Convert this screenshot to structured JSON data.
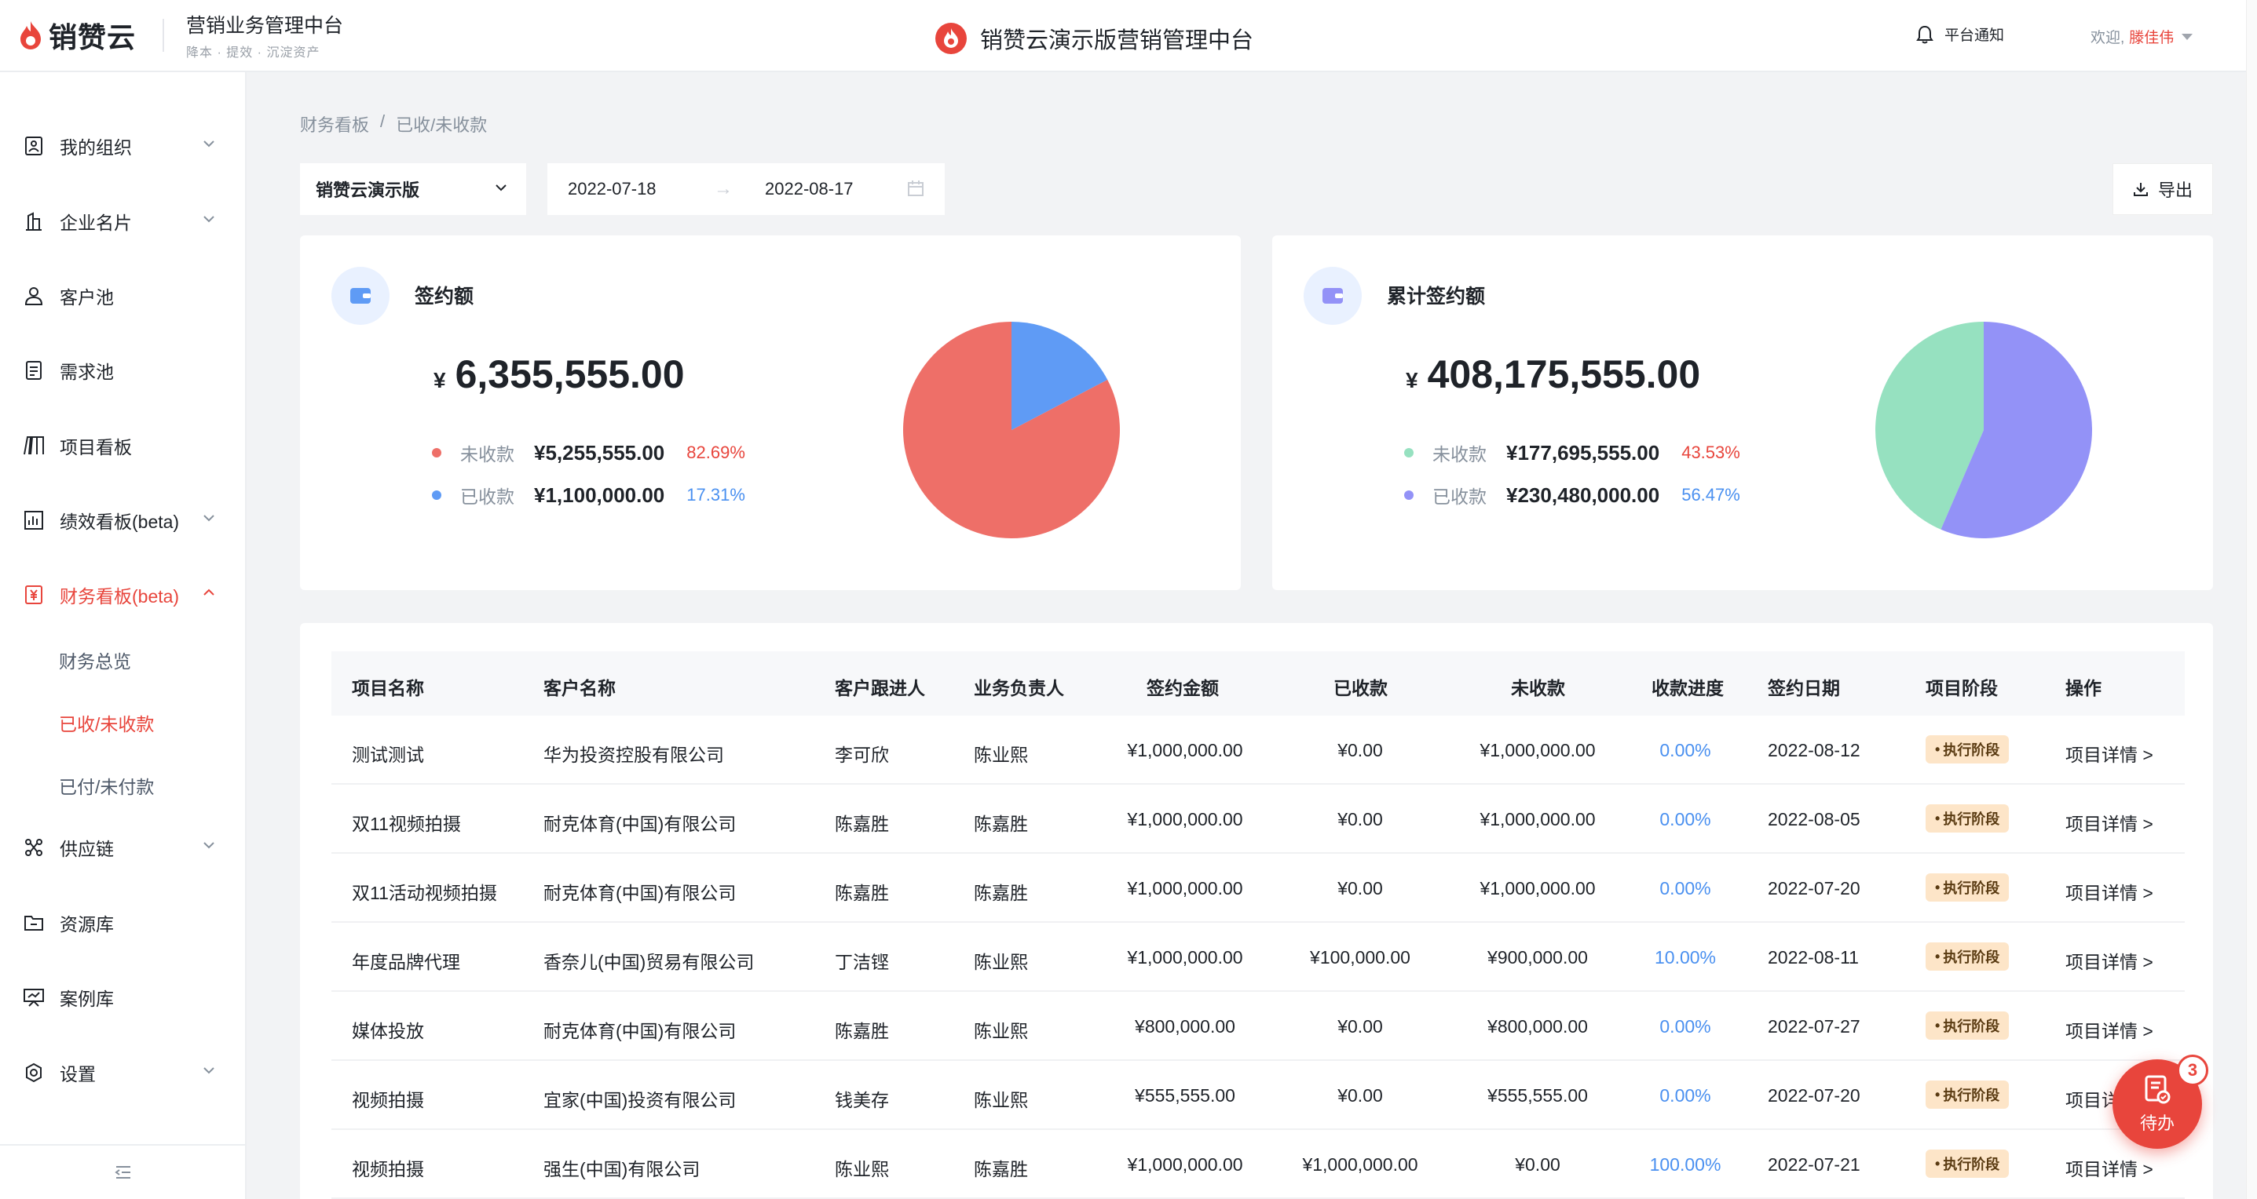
{
  "header": {
    "logo_text": "销赞云",
    "system_title": "营销业务管理中台",
    "system_subtitle": "降本 · 提效 · 沉淀资产",
    "center_title": "销赞云演示版营销管理中台",
    "notify_label": "平台通知",
    "welcome_label": "欢迎,",
    "username": "滕佳伟"
  },
  "sidebar": {
    "items": [
      {
        "label": "我的组织",
        "icon": "org-icon",
        "has_chevron": true
      },
      {
        "label": "企业名片",
        "icon": "building-icon",
        "has_chevron": true
      },
      {
        "label": "客户池",
        "icon": "user-icon",
        "has_chevron": false
      },
      {
        "label": "需求池",
        "icon": "list-icon",
        "has_chevron": false
      },
      {
        "label": "项目看板",
        "icon": "board-icon",
        "has_chevron": false
      },
      {
        "label": "绩效看板(beta)",
        "icon": "chart-icon",
        "has_chevron": true
      },
      {
        "label": "财务看板(beta)",
        "icon": "yen-icon",
        "has_chevron": true,
        "active": true
      },
      {
        "label": "供应链",
        "icon": "supply-icon",
        "has_chevron": true
      },
      {
        "label": "资源库",
        "icon": "folder-icon",
        "has_chevron": false
      },
      {
        "label": "案例库",
        "icon": "presentation-icon",
        "has_chevron": false
      },
      {
        "label": "设置",
        "icon": "gear-icon",
        "has_chevron": true
      }
    ],
    "sub_items": [
      {
        "label": "财务总览"
      },
      {
        "label": "已收/未收款",
        "active": true
      },
      {
        "label": "已付/未付款"
      }
    ]
  },
  "breadcrumb": {
    "parent": "财务看板",
    "separator": "/",
    "current": "已收/未收款"
  },
  "filters": {
    "org_select": "销赞云演示版",
    "date_start": "2022-07-18",
    "date_arrow": "→",
    "date_end": "2022-08-17",
    "export_label": "导出"
  },
  "colors": {
    "accent": "#e8453c",
    "uncollected_a": "#ee6f68",
    "collected_a": "#5f9bf5",
    "uncollected_b": "#96e1c0",
    "collected_b": "#9392f7",
    "pct_red": "#e8453c",
    "pct_blue": "#4a90f0"
  },
  "cards": [
    {
      "title": "签约额",
      "currency": "¥",
      "amount": "6,355,555.00",
      "rows": [
        {
          "label": "未收款",
          "amount": "¥5,255,555.00",
          "percent": "82.69%"
        },
        {
          "label": "已收款",
          "amount": "¥1,100,000.00",
          "percent": "17.31%"
        }
      ]
    },
    {
      "title": "累计签约额",
      "currency": "¥",
      "amount": "408,175,555.00",
      "rows": [
        {
          "label": "未收款",
          "amount": "¥177,695,555.00",
          "percent": "43.53%"
        },
        {
          "label": "已收款",
          "amount": "¥230,480,000.00",
          "percent": "56.47%"
        }
      ]
    }
  ],
  "chart_data": [
    {
      "type": "pie",
      "categories": [
        "未收款",
        "已收款"
      ],
      "values": [
        82.69,
        17.31
      ],
      "colors": [
        "#ee6f68",
        "#5f9bf5"
      ]
    },
    {
      "type": "pie",
      "categories": [
        "未收款",
        "已收款"
      ],
      "values": [
        43.53,
        56.47
      ],
      "colors": [
        "#96e1c0",
        "#9392f7"
      ]
    }
  ],
  "table": {
    "headers": [
      "项目名称",
      "客户名称",
      "客户跟进人",
      "业务负责人",
      "签约金额",
      "已收款",
      "未收款",
      "收款进度",
      "签约日期",
      "项目阶段",
      "操作"
    ],
    "rows": [
      [
        "测试测试",
        "华为投资控股有限公司",
        "李可欣",
        "陈业熙",
        "¥1,000,000.00",
        "¥0.00",
        "¥1,000,000.00",
        "0.00%",
        "2022-08-12",
        "执行阶段",
        "项目详情 >"
      ],
      [
        "双11视频拍摄",
        "耐克体育(中国)有限公司",
        "陈嘉胜",
        "陈嘉胜",
        "¥1,000,000.00",
        "¥0.00",
        "¥1,000,000.00",
        "0.00%",
        "2022-08-05",
        "执行阶段",
        "项目详情 >"
      ],
      [
        "双11活动视频拍摄",
        "耐克体育(中国)有限公司",
        "陈嘉胜",
        "陈嘉胜",
        "¥1,000,000.00",
        "¥0.00",
        "¥1,000,000.00",
        "0.00%",
        "2022-07-20",
        "执行阶段",
        "项目详情 >"
      ],
      [
        "年度品牌代理",
        "香奈儿(中国)贸易有限公司",
        "丁洁铿",
        "陈业熙",
        "¥1,000,000.00",
        "¥100,000.00",
        "¥900,000.00",
        "10.00%",
        "2022-08-11",
        "执行阶段",
        "项目详情 >"
      ],
      [
        "媒体投放",
        "耐克体育(中国)有限公司",
        "陈嘉胜",
        "陈业熙",
        "¥800,000.00",
        "¥0.00",
        "¥800,000.00",
        "0.00%",
        "2022-07-27",
        "执行阶段",
        "项目详情 >"
      ],
      [
        "视频拍摄",
        "宜家(中国)投资有限公司",
        "钱美存",
        "陈业熙",
        "¥555,555.00",
        "¥0.00",
        "¥555,555.00",
        "0.00%",
        "2022-07-20",
        "执行阶段",
        "项目详情 >"
      ],
      [
        "视频拍摄",
        "强生(中国)有限公司",
        "陈业熙",
        "陈嘉胜",
        "¥1,000,000.00",
        "¥1,000,000.00",
        "¥0.00",
        "100.00%",
        "2022-07-21",
        "执行阶段",
        "项目详情 >"
      ]
    ]
  },
  "todo": {
    "label": "待办",
    "count": "3"
  }
}
